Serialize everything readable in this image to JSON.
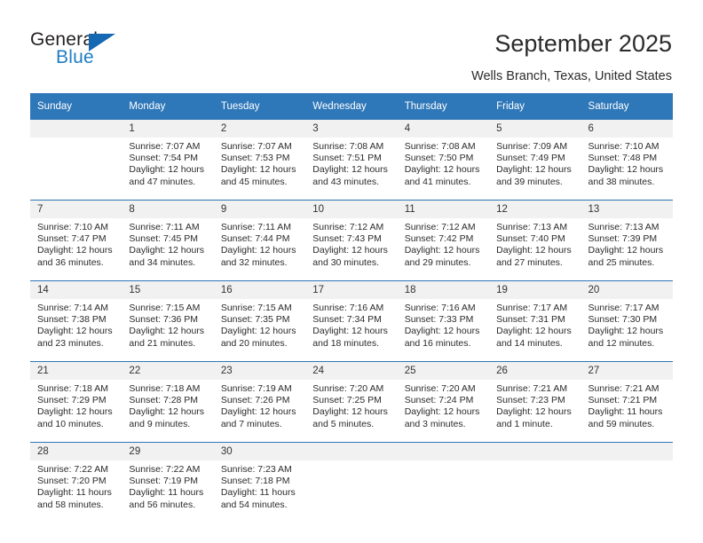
{
  "brand": {
    "name_top": "General",
    "name_bottom": "Blue",
    "accent_color": "#1f7ec4",
    "triangle_color": "#1668b3"
  },
  "header": {
    "title": "September 2025",
    "subtitle": "Wells Branch, Texas, United States"
  },
  "calendar": {
    "header_bg": "#2e77b8",
    "daynum_bg": "#f1f1f1",
    "weekday_names": [
      "Sunday",
      "Monday",
      "Tuesday",
      "Wednesday",
      "Thursday",
      "Friday",
      "Saturday"
    ],
    "weeks": [
      [
        {
          "day": "",
          "sunrise": "",
          "sunset": "",
          "daylight_1": "",
          "daylight_2": ""
        },
        {
          "day": "1",
          "sunrise": "Sunrise: 7:07 AM",
          "sunset": "Sunset: 7:54 PM",
          "daylight_1": "Daylight: 12 hours",
          "daylight_2": "and 47 minutes."
        },
        {
          "day": "2",
          "sunrise": "Sunrise: 7:07 AM",
          "sunset": "Sunset: 7:53 PM",
          "daylight_1": "Daylight: 12 hours",
          "daylight_2": "and 45 minutes."
        },
        {
          "day": "3",
          "sunrise": "Sunrise: 7:08 AM",
          "sunset": "Sunset: 7:51 PM",
          "daylight_1": "Daylight: 12 hours",
          "daylight_2": "and 43 minutes."
        },
        {
          "day": "4",
          "sunrise": "Sunrise: 7:08 AM",
          "sunset": "Sunset: 7:50 PM",
          "daylight_1": "Daylight: 12 hours",
          "daylight_2": "and 41 minutes."
        },
        {
          "day": "5",
          "sunrise": "Sunrise: 7:09 AM",
          "sunset": "Sunset: 7:49 PM",
          "daylight_1": "Daylight: 12 hours",
          "daylight_2": "and 39 minutes."
        },
        {
          "day": "6",
          "sunrise": "Sunrise: 7:10 AM",
          "sunset": "Sunset: 7:48 PM",
          "daylight_1": "Daylight: 12 hours",
          "daylight_2": "and 38 minutes."
        }
      ],
      [
        {
          "day": "7",
          "sunrise": "Sunrise: 7:10 AM",
          "sunset": "Sunset: 7:47 PM",
          "daylight_1": "Daylight: 12 hours",
          "daylight_2": "and 36 minutes."
        },
        {
          "day": "8",
          "sunrise": "Sunrise: 7:11 AM",
          "sunset": "Sunset: 7:45 PM",
          "daylight_1": "Daylight: 12 hours",
          "daylight_2": "and 34 minutes."
        },
        {
          "day": "9",
          "sunrise": "Sunrise: 7:11 AM",
          "sunset": "Sunset: 7:44 PM",
          "daylight_1": "Daylight: 12 hours",
          "daylight_2": "and 32 minutes."
        },
        {
          "day": "10",
          "sunrise": "Sunrise: 7:12 AM",
          "sunset": "Sunset: 7:43 PM",
          "daylight_1": "Daylight: 12 hours",
          "daylight_2": "and 30 minutes."
        },
        {
          "day": "11",
          "sunrise": "Sunrise: 7:12 AM",
          "sunset": "Sunset: 7:42 PM",
          "daylight_1": "Daylight: 12 hours",
          "daylight_2": "and 29 minutes."
        },
        {
          "day": "12",
          "sunrise": "Sunrise: 7:13 AM",
          "sunset": "Sunset: 7:40 PM",
          "daylight_1": "Daylight: 12 hours",
          "daylight_2": "and 27 minutes."
        },
        {
          "day": "13",
          "sunrise": "Sunrise: 7:13 AM",
          "sunset": "Sunset: 7:39 PM",
          "daylight_1": "Daylight: 12 hours",
          "daylight_2": "and 25 minutes."
        }
      ],
      [
        {
          "day": "14",
          "sunrise": "Sunrise: 7:14 AM",
          "sunset": "Sunset: 7:38 PM",
          "daylight_1": "Daylight: 12 hours",
          "daylight_2": "and 23 minutes."
        },
        {
          "day": "15",
          "sunrise": "Sunrise: 7:15 AM",
          "sunset": "Sunset: 7:36 PM",
          "daylight_1": "Daylight: 12 hours",
          "daylight_2": "and 21 minutes."
        },
        {
          "day": "16",
          "sunrise": "Sunrise: 7:15 AM",
          "sunset": "Sunset: 7:35 PM",
          "daylight_1": "Daylight: 12 hours",
          "daylight_2": "and 20 minutes."
        },
        {
          "day": "17",
          "sunrise": "Sunrise: 7:16 AM",
          "sunset": "Sunset: 7:34 PM",
          "daylight_1": "Daylight: 12 hours",
          "daylight_2": "and 18 minutes."
        },
        {
          "day": "18",
          "sunrise": "Sunrise: 7:16 AM",
          "sunset": "Sunset: 7:33 PM",
          "daylight_1": "Daylight: 12 hours",
          "daylight_2": "and 16 minutes."
        },
        {
          "day": "19",
          "sunrise": "Sunrise: 7:17 AM",
          "sunset": "Sunset: 7:31 PM",
          "daylight_1": "Daylight: 12 hours",
          "daylight_2": "and 14 minutes."
        },
        {
          "day": "20",
          "sunrise": "Sunrise: 7:17 AM",
          "sunset": "Sunset: 7:30 PM",
          "daylight_1": "Daylight: 12 hours",
          "daylight_2": "and 12 minutes."
        }
      ],
      [
        {
          "day": "21",
          "sunrise": "Sunrise: 7:18 AM",
          "sunset": "Sunset: 7:29 PM",
          "daylight_1": "Daylight: 12 hours",
          "daylight_2": "and 10 minutes."
        },
        {
          "day": "22",
          "sunrise": "Sunrise: 7:18 AM",
          "sunset": "Sunset: 7:28 PM",
          "daylight_1": "Daylight: 12 hours",
          "daylight_2": "and 9 minutes."
        },
        {
          "day": "23",
          "sunrise": "Sunrise: 7:19 AM",
          "sunset": "Sunset: 7:26 PM",
          "daylight_1": "Daylight: 12 hours",
          "daylight_2": "and 7 minutes."
        },
        {
          "day": "24",
          "sunrise": "Sunrise: 7:20 AM",
          "sunset": "Sunset: 7:25 PM",
          "daylight_1": "Daylight: 12 hours",
          "daylight_2": "and 5 minutes."
        },
        {
          "day": "25",
          "sunrise": "Sunrise: 7:20 AM",
          "sunset": "Sunset: 7:24 PM",
          "daylight_1": "Daylight: 12 hours",
          "daylight_2": "and 3 minutes."
        },
        {
          "day": "26",
          "sunrise": "Sunrise: 7:21 AM",
          "sunset": "Sunset: 7:23 PM",
          "daylight_1": "Daylight: 12 hours",
          "daylight_2": "and 1 minute."
        },
        {
          "day": "27",
          "sunrise": "Sunrise: 7:21 AM",
          "sunset": "Sunset: 7:21 PM",
          "daylight_1": "Daylight: 11 hours",
          "daylight_2": "and 59 minutes."
        }
      ],
      [
        {
          "day": "28",
          "sunrise": "Sunrise: 7:22 AM",
          "sunset": "Sunset: 7:20 PM",
          "daylight_1": "Daylight: 11 hours",
          "daylight_2": "and 58 minutes."
        },
        {
          "day": "29",
          "sunrise": "Sunrise: 7:22 AM",
          "sunset": "Sunset: 7:19 PM",
          "daylight_1": "Daylight: 11 hours",
          "daylight_2": "and 56 minutes."
        },
        {
          "day": "30",
          "sunrise": "Sunrise: 7:23 AM",
          "sunset": "Sunset: 7:18 PM",
          "daylight_1": "Daylight: 11 hours",
          "daylight_2": "and 54 minutes."
        },
        {
          "day": "",
          "sunrise": "",
          "sunset": "",
          "daylight_1": "",
          "daylight_2": ""
        },
        {
          "day": "",
          "sunrise": "",
          "sunset": "",
          "daylight_1": "",
          "daylight_2": ""
        },
        {
          "day": "",
          "sunrise": "",
          "sunset": "",
          "daylight_1": "",
          "daylight_2": ""
        },
        {
          "day": "",
          "sunrise": "",
          "sunset": "",
          "daylight_1": "",
          "daylight_2": ""
        }
      ]
    ]
  }
}
